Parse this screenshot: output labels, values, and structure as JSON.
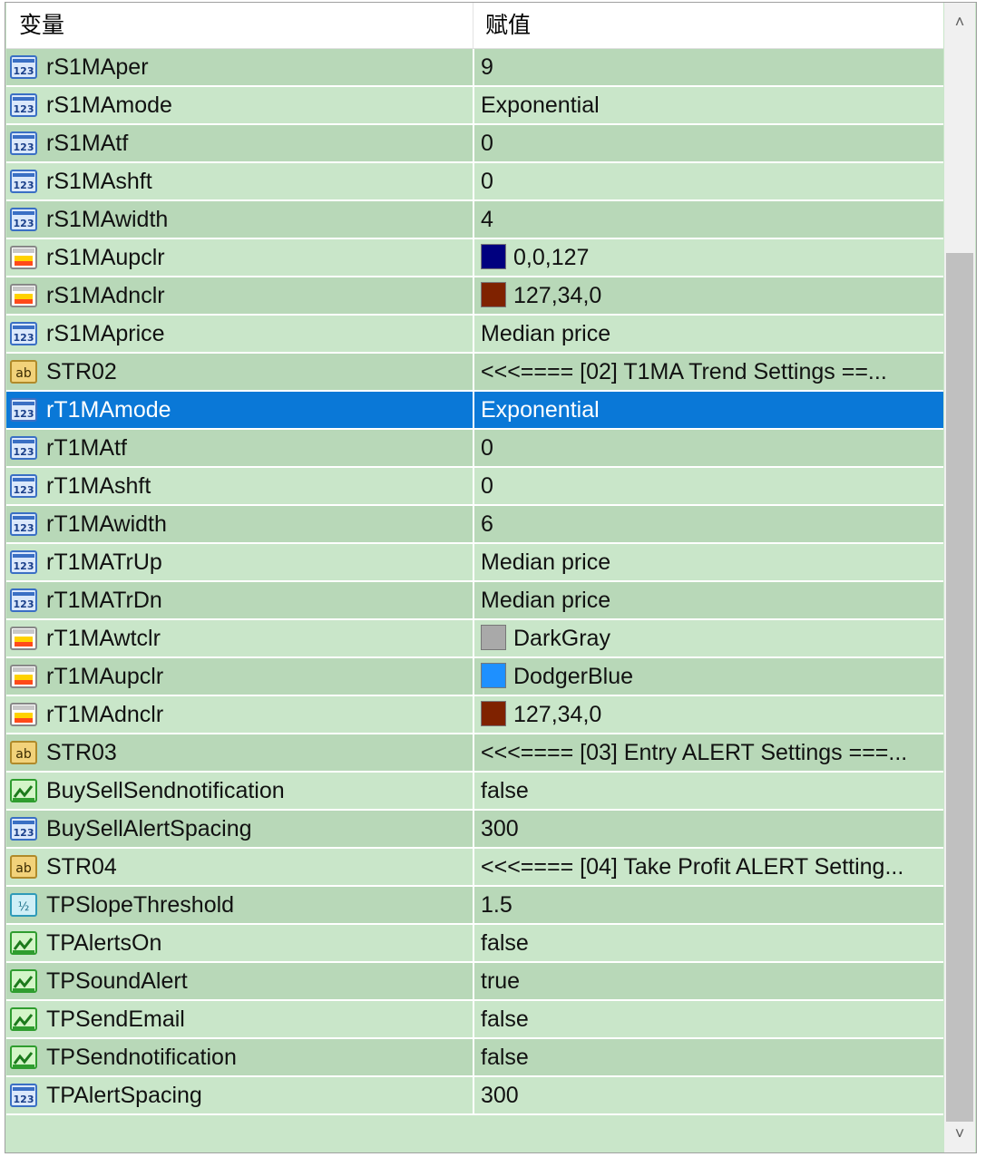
{
  "header": {
    "col_variable": "变量",
    "col_value": "赋值"
  },
  "rows": [
    {
      "type": "int",
      "name": "rS1MAper",
      "value": "9"
    },
    {
      "type": "int",
      "name": "rS1MAmode",
      "value": "Exponential"
    },
    {
      "type": "int",
      "name": "rS1MAtf",
      "value": "0"
    },
    {
      "type": "int",
      "name": "rS1MAshft",
      "value": "0"
    },
    {
      "type": "int",
      "name": "rS1MAwidth",
      "value": "4"
    },
    {
      "type": "color",
      "name": "rS1MAupclr",
      "value": "0,0,127",
      "swatch": "#00007f"
    },
    {
      "type": "color",
      "name": "rS1MAdnclr",
      "value": "127,34,0",
      "swatch": "#7f2200"
    },
    {
      "type": "int",
      "name": "rS1MAprice",
      "value": "Median price"
    },
    {
      "type": "string",
      "name": "STR02",
      "value": "<<<==== [02] T1MA Trend Settings ==..."
    },
    {
      "type": "int",
      "name": "rT1MAmode",
      "value": "Exponential",
      "selected": true
    },
    {
      "type": "int",
      "name": "rT1MAtf",
      "value": "0"
    },
    {
      "type": "int",
      "name": "rT1MAshft",
      "value": "0"
    },
    {
      "type": "int",
      "name": "rT1MAwidth",
      "value": "6"
    },
    {
      "type": "int",
      "name": "rT1MATrUp",
      "value": "Median price"
    },
    {
      "type": "int",
      "name": "rT1MATrDn",
      "value": "Median price"
    },
    {
      "type": "color",
      "name": "rT1MAwtclr",
      "value": "DarkGray",
      "swatch": "#a9a9a9"
    },
    {
      "type": "color",
      "name": "rT1MAupclr",
      "value": "DodgerBlue",
      "swatch": "#1e90ff"
    },
    {
      "type": "color",
      "name": "rT1MAdnclr",
      "value": "127,34,0",
      "swatch": "#7f2200"
    },
    {
      "type": "string",
      "name": "STR03",
      "value": "<<<==== [03] Entry ALERT Settings ===..."
    },
    {
      "type": "bool",
      "name": "BuySellSendnotification",
      "value": "false"
    },
    {
      "type": "int",
      "name": "BuySellAlertSpacing",
      "value": "300"
    },
    {
      "type": "string",
      "name": "STR04",
      "value": "<<<==== [04] Take Profit ALERT Setting..."
    },
    {
      "type": "double",
      "name": "TPSlopeThreshold",
      "value": "1.5"
    },
    {
      "type": "bool",
      "name": "TPAlertsOn",
      "value": "false"
    },
    {
      "type": "bool",
      "name": "TPSoundAlert",
      "value": "true"
    },
    {
      "type": "bool",
      "name": "TPSendEmail",
      "value": "false"
    },
    {
      "type": "bool",
      "name": "TPSendnotification",
      "value": "false"
    },
    {
      "type": "int",
      "name": "TPAlertSpacing",
      "value": "300"
    }
  ],
  "icons": {
    "int": "integer-icon",
    "color": "color-icon",
    "string": "string-icon",
    "bool": "boolean-icon",
    "double": "double-icon"
  },
  "colors": {
    "row_light": "#c9e6c9",
    "row_dark": "#b8d8b8",
    "selected": "#0a78d7"
  }
}
